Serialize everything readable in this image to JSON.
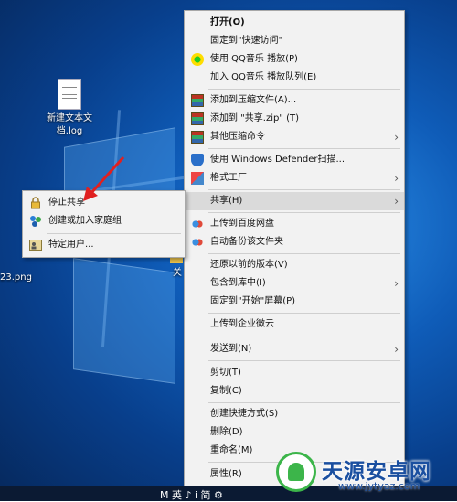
{
  "desktop": {
    "icons": [
      {
        "label_line1": "新建文本文",
        "label_line2": "档.log"
      },
      {
        "label": "23.png"
      },
      {
        "label": "关"
      }
    ]
  },
  "context_menu": {
    "items": [
      {
        "label": "打开(O)"
      },
      {
        "label": "固定到\"快速访问\""
      },
      {
        "label": "使用 QQ音乐 播放(P)"
      },
      {
        "label": "加入 QQ音乐 播放队列(E)"
      },
      {
        "label": "添加到压缩文件(A)..."
      },
      {
        "label": "添加到 \"共享.zip\" (T)"
      },
      {
        "label": "其他压缩命令"
      },
      {
        "label": "使用 Windows Defender扫描..."
      },
      {
        "label": "格式工厂"
      },
      {
        "label": "共享(H)"
      },
      {
        "label": "上传到百度网盘"
      },
      {
        "label": "自动备份该文件夹"
      },
      {
        "label": "还原以前的版本(V)"
      },
      {
        "label": "包含到库中(I)"
      },
      {
        "label": "固定到\"开始\"屏幕(P)"
      },
      {
        "label": "上传到企业微云"
      },
      {
        "label": "发送到(N)"
      },
      {
        "label": "剪切(T)"
      },
      {
        "label": "复制(C)"
      },
      {
        "label": "创建快捷方式(S)"
      },
      {
        "label": "删除(D)"
      },
      {
        "label": "重命名(M)"
      },
      {
        "label": "属性(R)"
      }
    ]
  },
  "share_submenu": {
    "items": [
      {
        "label": "停止共享"
      },
      {
        "label": "创建或加入家庭组"
      },
      {
        "label": "特定用户..."
      }
    ]
  },
  "watermark": {
    "title": "天源安卓网",
    "url": "www.jytyaz.com"
  },
  "taskbar": {
    "text": "M 英 ♪ ⅰ 简 ⚙"
  }
}
